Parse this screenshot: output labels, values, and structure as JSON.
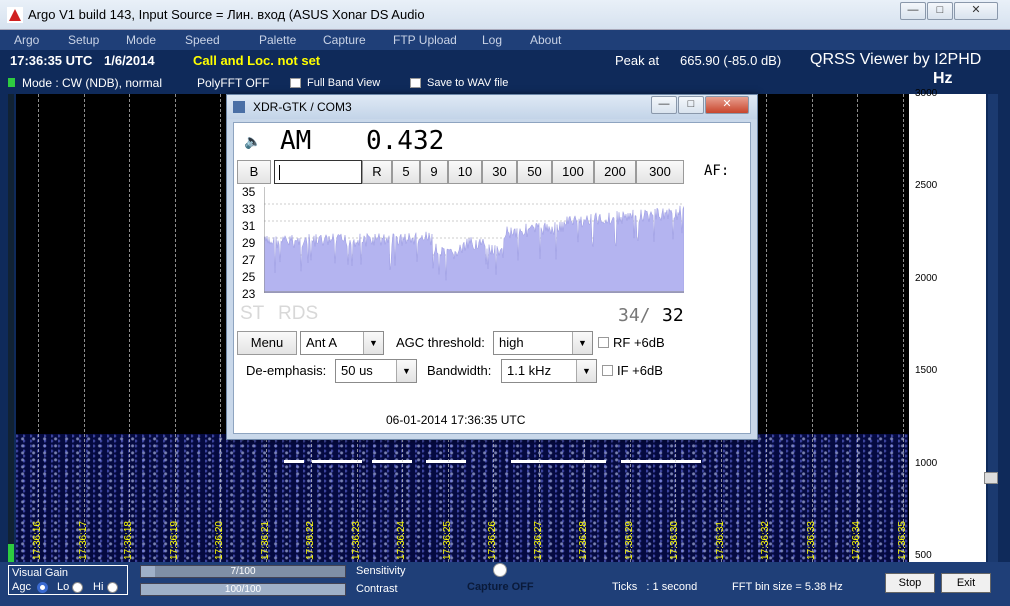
{
  "window": {
    "title": "Argo V1 build 143, Input Source = Лин. вход (ASUS Xonar DS Audio",
    "controls": [
      "—",
      "□",
      "✕"
    ]
  },
  "menu": [
    "Argo",
    "Setup",
    "Mode",
    "Speed",
    "Palette",
    "Capture",
    "FTP Upload",
    "Log",
    "About"
  ],
  "info": {
    "time": "17:36:35 UTC",
    "date": "1/6/2014",
    "call": "Call and Loc. not set",
    "peak_label": "Peak at",
    "peak_value": "665.90 (-85.0 dB)",
    "brand": "QRSS Viewer by I2PHD",
    "unit": "Hz",
    "mode": "Mode : CW (NDB), normal",
    "polyfft": "PolyFFT OFF",
    "full_band": "Full Band View",
    "save_wav": "Save to WAV file"
  },
  "waterfall": {
    "time_labels": [
      "17:36:16",
      "17:36:17",
      "17:36:18",
      "17:36:19",
      "17:36:20",
      "17:36:21",
      "17:36:22",
      "17:36:23",
      "17:36:24",
      "17:36:25",
      "17:36:26",
      "17:36:27",
      "17:36:28",
      "17:36:29",
      "17:36:30",
      "17:36:31",
      "17:36:32",
      "17:36:33",
      "17:36:34",
      "17:36:35"
    ],
    "freq_labels": [
      "3000",
      "2500",
      "2000",
      "1500",
      "1000",
      "500"
    ]
  },
  "bottom": {
    "visual_gain": "Visual Gain",
    "agc": "Agc",
    "lo": "Lo",
    "hi": "Hi",
    "sensitivity_value": "7/100",
    "sensitivity_fraction": 0.07,
    "sensitivity_label": "Sensitivity",
    "contrast_value": "100/100",
    "contrast_fraction": 1.0,
    "contrast_label": "Contrast",
    "capture": "Capture OFF",
    "ticks": "Ticks   : 1 second",
    "fft_bin": "FFT bin size = 5.38 Hz",
    "stop": "Stop",
    "exit": "Exit"
  },
  "dialog": {
    "title": "XDR-GTK / COM3",
    "mode": "AM",
    "frequency": "0.432",
    "buttons": [
      "B",
      "R",
      "5",
      "9",
      "10",
      "30",
      "50",
      "100",
      "200",
      "300"
    ],
    "af_label": "AF:",
    "yaxis": [
      "35",
      "33",
      "31",
      "29",
      "27",
      "25",
      "23"
    ],
    "st": "ST",
    "rds": "RDS",
    "signal_a": "34/",
    "signal_b": "32",
    "menu_btn": "Menu",
    "antenna": "Ant A",
    "agc_label": "AGC threshold:",
    "agc_value": "high",
    "rf_label": "RF +6dB",
    "deemph_label": "De-emphasis:",
    "deemph_value": "50 us",
    "bw_label": "Bandwidth:",
    "bw_value": "1.1 kHz",
    "if_label": "IF +6dB",
    "timestamp": "06-01-2014 17:36:35 UTC"
  },
  "colors": {
    "waterfall_bg": "#000000",
    "time_label": "#ffff00",
    "call_text": "#ffff00",
    "spectrum_fill": "#b4b4f0"
  }
}
